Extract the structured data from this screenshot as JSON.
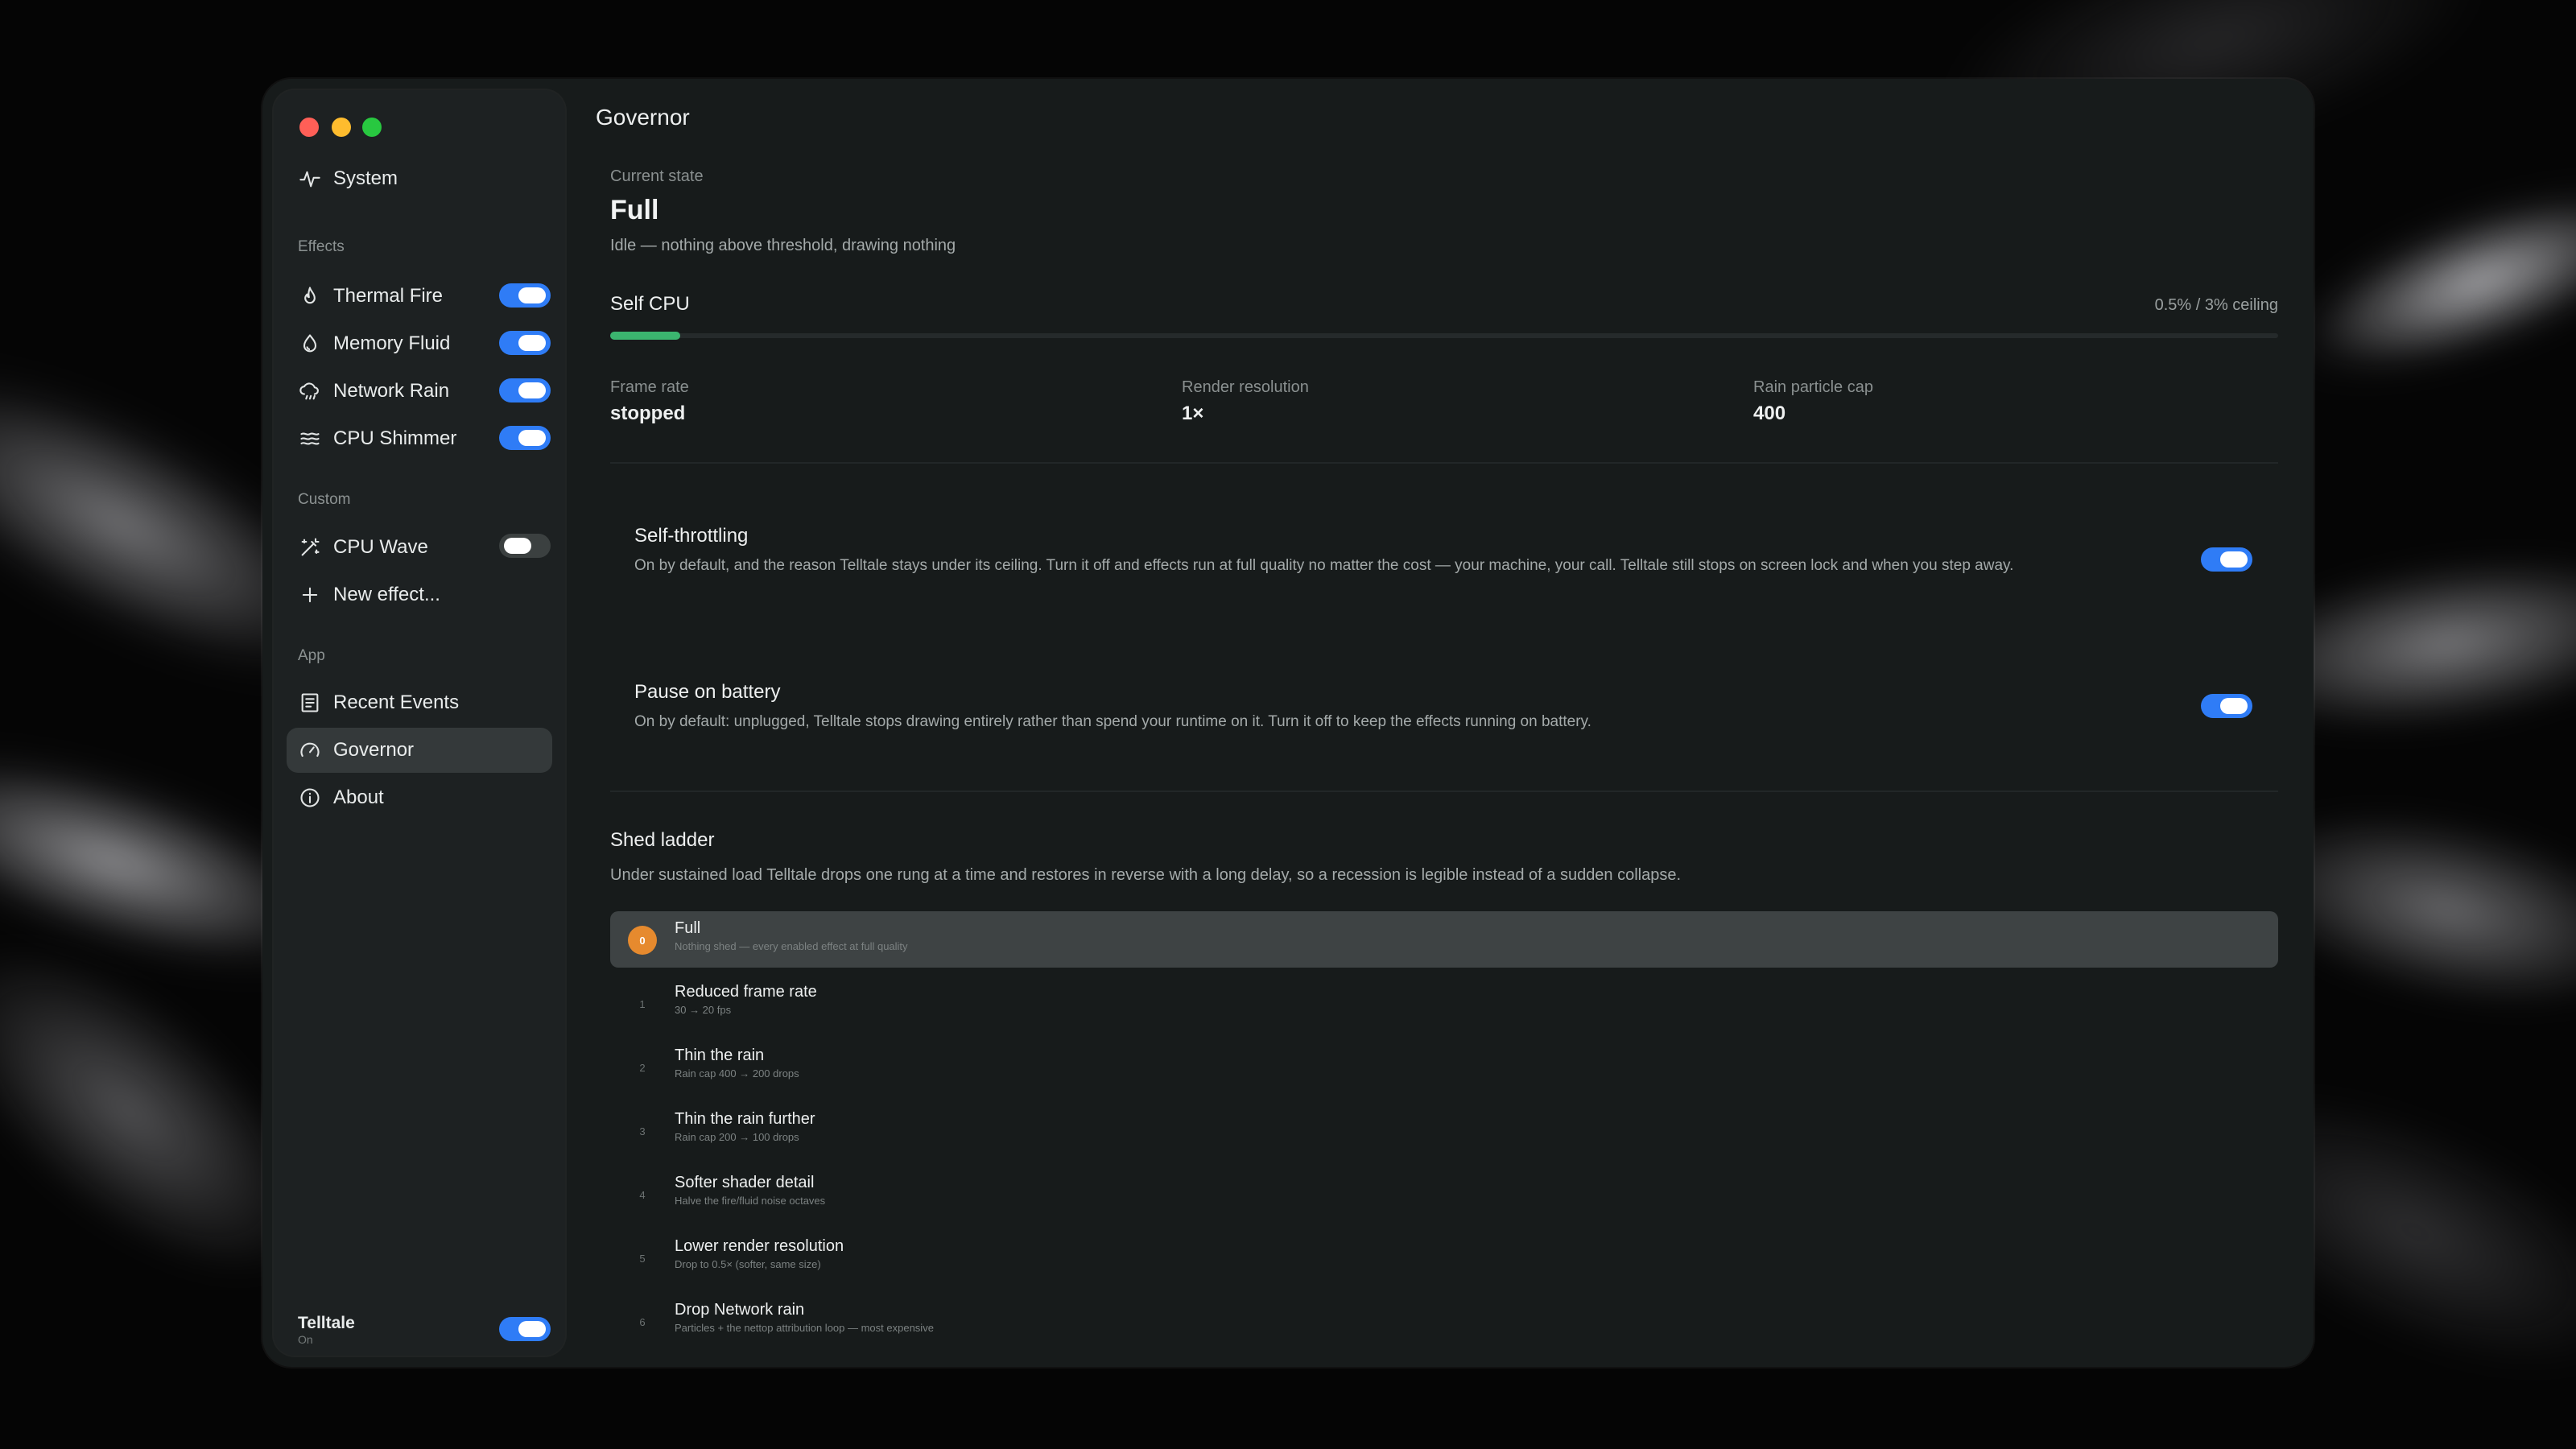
{
  "window": {
    "title": "Governor"
  },
  "sidebar": {
    "system_item": {
      "label": "System",
      "icon": "activity-icon"
    },
    "sections": {
      "effects": "Effects",
      "custom": "Custom",
      "app": "App"
    },
    "effects": [
      {
        "label": "Thermal Fire",
        "icon": "flame-icon",
        "enabled": true
      },
      {
        "label": "Memory Fluid",
        "icon": "fluid-icon",
        "enabled": true
      },
      {
        "label": "Network Rain",
        "icon": "cloud-rain-icon",
        "enabled": true
      },
      {
        "label": "CPU Shimmer",
        "icon": "waves-icon",
        "enabled": true
      }
    ],
    "custom": [
      {
        "label": "CPU Wave",
        "icon": "magic-wand-icon",
        "enabled": false
      },
      {
        "label": "New effect...",
        "icon": "plus-icon"
      }
    ],
    "app": [
      {
        "label": "Recent Events",
        "icon": "list-icon"
      },
      {
        "label": "Governor",
        "icon": "gauge-icon",
        "active": true
      },
      {
        "label": "About",
        "icon": "info-icon"
      }
    ],
    "footer": {
      "name": "Telltale",
      "status": "On",
      "enabled": true
    }
  },
  "governor": {
    "current_state_label": "Current state",
    "current_state": "Full",
    "state_description": "Idle — nothing above threshold, drawing nothing",
    "self_cpu_label": "Self CPU",
    "self_cpu_readout": "0.5% / 3% ceiling",
    "self_cpu_fraction": 0.042,
    "stats": [
      {
        "label": "Frame rate",
        "value": "stopped"
      },
      {
        "label": "Render resolution",
        "value": "1×"
      },
      {
        "label": "Rain particle cap",
        "value": "400"
      }
    ],
    "self_throttling": {
      "title": "Self-throttling",
      "description": "On by default, and the reason Telltale stays under its ceiling. Turn it off and effects run at full quality no matter the cost — your machine, your call. Telltale still stops on screen lock and when you step away.",
      "enabled": true
    },
    "pause_on_battery": {
      "title": "Pause on battery",
      "description": "On by default: unplugged, Telltale stops drawing entirely rather than spend your runtime on it. Turn it off to keep the effects running on battery.",
      "enabled": true
    },
    "shed_ladder": {
      "title": "Shed ladder",
      "description": "Under sustained load Telltale drops one rung at a time and restores in reverse with a long delay, so a recession is legible instead of a sudden collapse.",
      "rungs": [
        {
          "num": "0",
          "title": "Full",
          "subtitle": "Nothing shed — every enabled effect at full quality",
          "active": true
        },
        {
          "num": "1",
          "title": "Reduced frame rate",
          "subtitle": "30 → 20 fps"
        },
        {
          "num": "2",
          "title": "Thin the rain",
          "subtitle": "Rain cap 400 → 200 drops"
        },
        {
          "num": "3",
          "title": "Thin the rain further",
          "subtitle": "Rain cap 200 → 100 drops"
        },
        {
          "num": "4",
          "title": "Softer shader detail",
          "subtitle": "Halve the fire/fluid noise octaves"
        },
        {
          "num": "5",
          "title": "Lower render resolution",
          "subtitle": "Drop to 0.5× (softer, same size)"
        },
        {
          "num": "6",
          "title": "Drop Network rain",
          "subtitle": "Particles + the nettop attribution loop — most expensive"
        }
      ]
    }
  },
  "colors": {
    "accent": "#2f7cf6",
    "cpu_bar": "#3bb56f",
    "active_rung": "#e68a2e",
    "window_bg": "#171b1b",
    "sidebar_bg": "#1d2122"
  }
}
